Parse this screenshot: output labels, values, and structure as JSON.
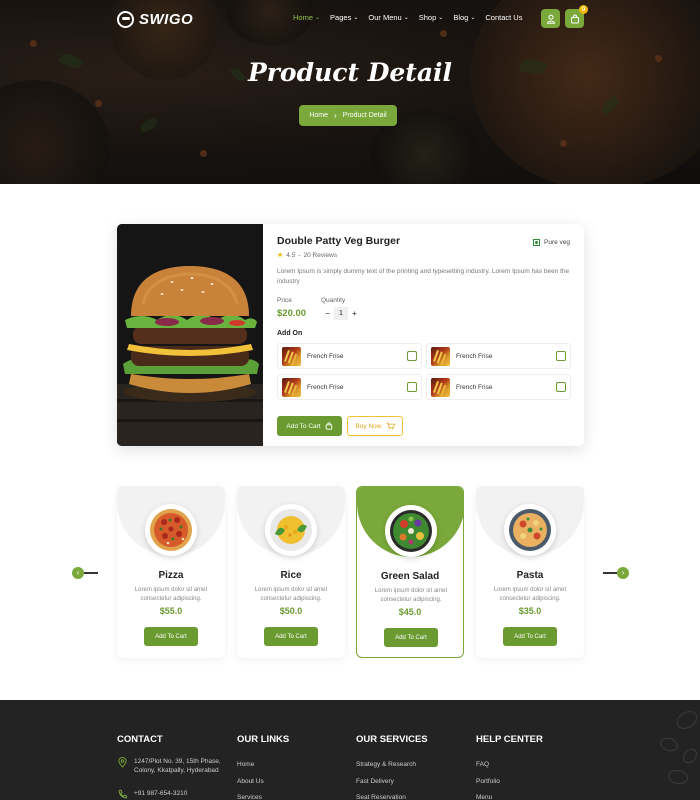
{
  "brand": {
    "name": "SWIGO"
  },
  "nav": {
    "items": [
      {
        "label": "Home",
        "caret": "⌄",
        "active": true
      },
      {
        "label": "Pages",
        "caret": "⌄"
      },
      {
        "label": "Our Menu",
        "caret": "⌄"
      },
      {
        "label": "Shop",
        "caret": "⌄"
      },
      {
        "label": "Blog",
        "caret": "⌄"
      },
      {
        "label": "Contact Us",
        "caret": ""
      }
    ],
    "cart_count": "0"
  },
  "hero": {
    "title": "Product Detail",
    "breadcrumb": {
      "home": "Home",
      "separator": "›",
      "current": "Product Detail"
    }
  },
  "product": {
    "title": "Double Patty Veg Burger",
    "veg_label": "Pure veg",
    "rating": "4.5",
    "reviews": "20 Reviews",
    "description": "Lorem Ipsum is simply dummy text of the printing and typesetting industry. Lorem Ipsum has been the industry",
    "price_label": "Price",
    "price": "$20.00",
    "quantity_label": "Quantity",
    "quantity": "1",
    "addon_heading": "Add On",
    "addons": [
      {
        "name": "French Frise"
      },
      {
        "name": "French Frise"
      },
      {
        "name": "French Frise"
      },
      {
        "name": "French Frise"
      }
    ],
    "add_to_cart": "Add To Cart",
    "buy_now": "Buy Now"
  },
  "dishes": [
    {
      "name": "Pizza",
      "desc": "Lorem ipsum dolor sit amet consectetur adipiscing.",
      "price": "$55.0",
      "button": "Add To Cart",
      "active": false
    },
    {
      "name": "Rice",
      "desc": "Lorem ipsum dolor sit amet consectetur adipiscing.",
      "price": "$50.0",
      "button": "Add To Cart",
      "active": false
    },
    {
      "name": "Green Salad",
      "desc": "Lorem ipsum dolor sit amet consectetur adipiscing.",
      "price": "$45.0",
      "button": "Add To Cart",
      "active": true
    },
    {
      "name": "Pasta",
      "desc": "Lorem ipsum dolor sit amet consectetur adipiscing.",
      "price": "$35.0",
      "button": "Add To Cart",
      "active": false
    }
  ],
  "footer": {
    "contact": {
      "heading": "CONTACT",
      "address": "1247/Plot No. 39, 15th Phase, Colony, Kkatpally, Hyderabad",
      "phone": "+91 987-654-3210"
    },
    "links": {
      "heading": "OUR LINKS",
      "items": [
        "Home",
        "About Us",
        "Services"
      ]
    },
    "services": {
      "heading": "OUR SERVICES",
      "items": [
        "Strategy & Research",
        "Fast Delivery",
        "Seat Reservation"
      ]
    },
    "help": {
      "heading": "HELP CENTER",
      "items": [
        "FAQ",
        "Portfolio",
        "Menu"
      ]
    }
  },
  "colors": {
    "accent": "#7aa83a",
    "accent_dark": "#6a9a30",
    "footer_bg": "#232323",
    "buy_outline": "#f2c230"
  }
}
